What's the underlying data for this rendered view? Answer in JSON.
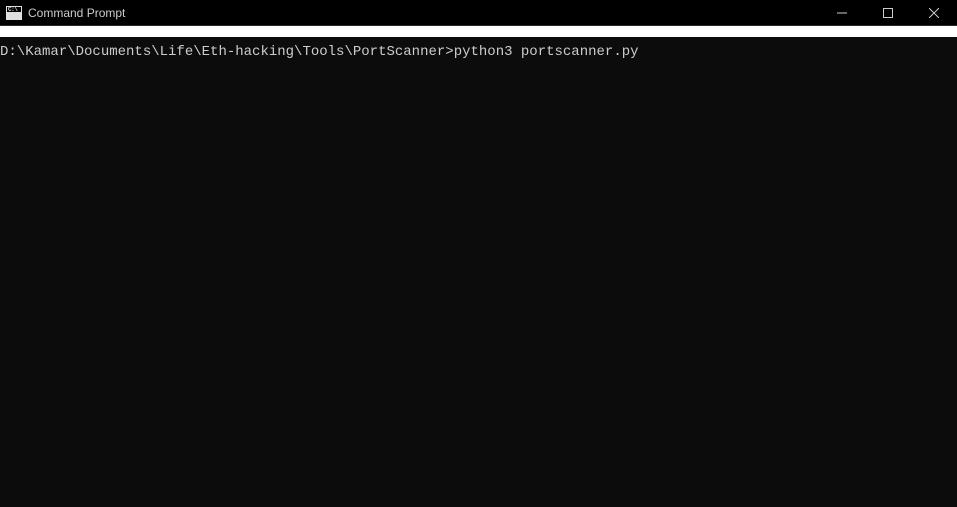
{
  "window": {
    "title": "Command Prompt",
    "icon_label": "C:\\"
  },
  "terminal": {
    "prompt_drive": "D",
    "prompt_path": ":\\Kamar\\Documents\\Life\\Eth-hacking\\Tools\\PortScanner>",
    "command": "python3 portscanner.py"
  }
}
